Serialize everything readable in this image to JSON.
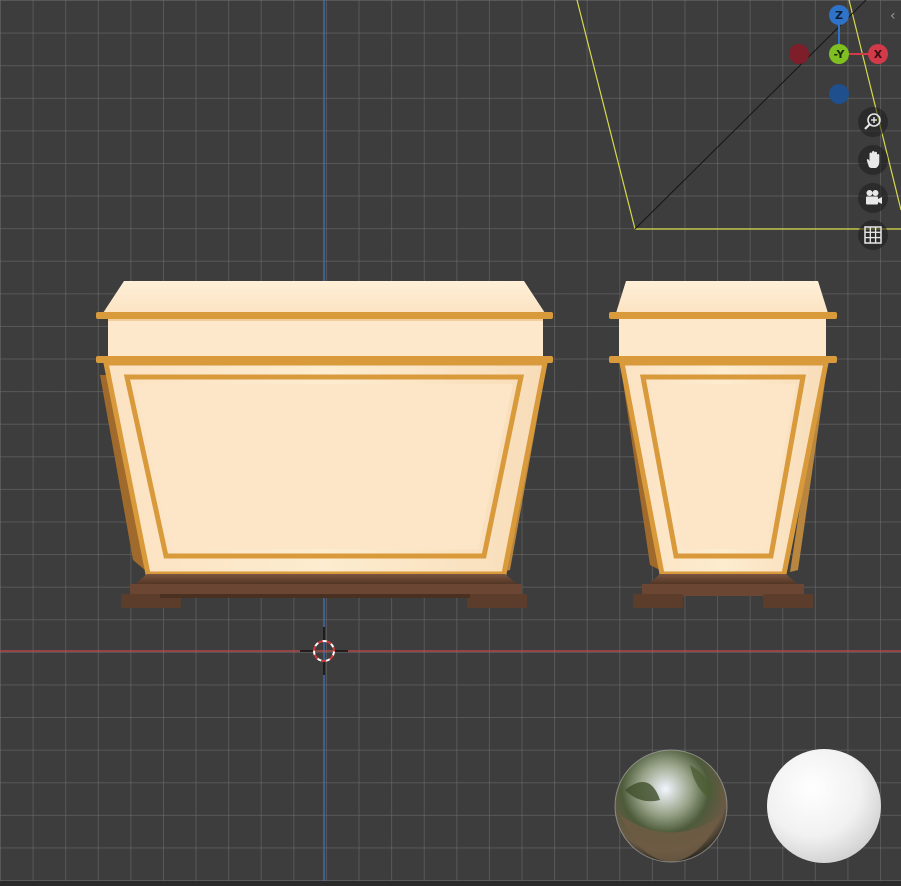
{
  "viewport": {
    "background": "#3d3d3d",
    "x_axis_color": "#c44a4a",
    "y_axis_color": "#3f74c9"
  },
  "gizmo": {
    "z_label": "Z",
    "y_label": "-Y",
    "x_label": "X",
    "z_color": "#2f73c8",
    "y_color": "#7fbf22",
    "x_color": "#d23a4a"
  },
  "nav_tools": [
    {
      "name": "zoom-icon"
    },
    {
      "name": "pan-hand-icon"
    },
    {
      "name": "camera-icon"
    },
    {
      "name": "grid-ortho-icon"
    }
  ],
  "objects": {
    "cabinet_body_color": "#fde8cc",
    "cabinet_trim_color": "#d99a3c",
    "base_wood_color": "#6b4632"
  },
  "hdri_previews": [
    {
      "name": "chrome-sphere"
    },
    {
      "name": "diffuse-sphere"
    }
  ]
}
